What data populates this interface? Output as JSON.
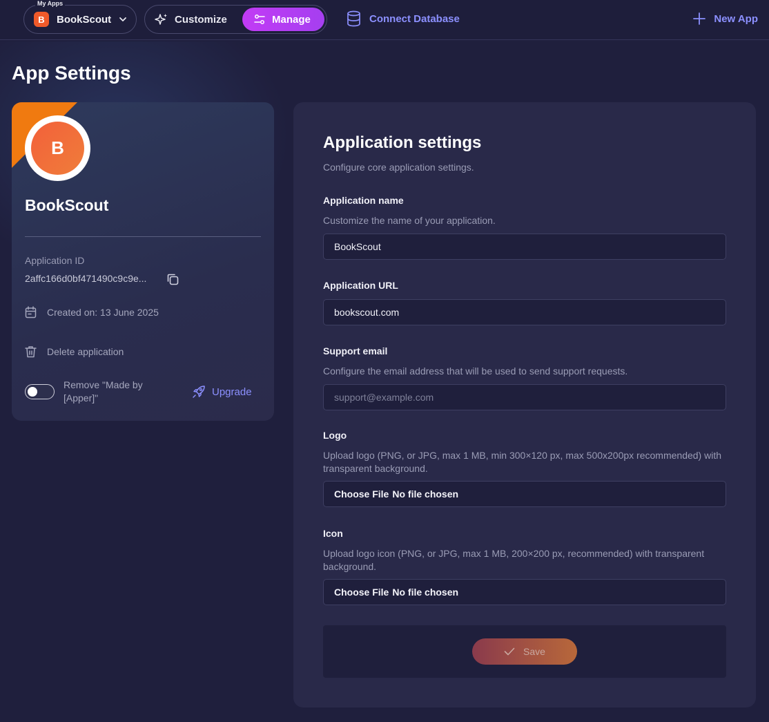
{
  "topbar": {
    "app_switch_legend": "My Apps",
    "app_initial": "B",
    "app_name": "BookScout",
    "mode_customize": "Customize",
    "mode_manage": "Manage",
    "connect_database": "Connect Database",
    "new_app": "New App"
  },
  "page": {
    "title": "App Settings"
  },
  "side": {
    "avatar_initial": "B",
    "app_name": "BookScout",
    "id_label": "Application ID",
    "id_value": "2affc166d0bf471490c9c9e...",
    "created_on": "Created on: 13 June 2025",
    "delete_label": "Delete application",
    "remove_label": "Remove \"Made by [Apper]\"",
    "toggle_on": false,
    "upgrade_label": "Upgrade"
  },
  "settings": {
    "title": "Application settings",
    "subtitle": "Configure core application settings.",
    "name_label": "Application name",
    "name_help": "Customize the name of your application.",
    "name_value": "BookScout",
    "url_label": "Application URL",
    "url_value": "bookscout.com",
    "email_label": "Support email",
    "email_help": "Configure the email address that will be used to send support requests.",
    "email_placeholder": "support@example.com",
    "logo_label": "Logo",
    "logo_help": "Upload logo (PNG, or JPG, max 1 MB, min 300×120 px, max 500x200px recommended) with transparent background.",
    "logo_choose": "Choose File",
    "logo_status": "No file chosen",
    "icon_label": "Icon",
    "icon_help": "Upload logo icon (PNG, or JPG, max 1 MB, 200×200 px, recommended) with transparent background.",
    "icon_choose": "Choose File",
    "icon_status": "No file chosen",
    "save_label": "Save"
  },
  "colors": {
    "background": "#1f1f3d",
    "card": "#292949",
    "accent_purple": "#c23bf5",
    "link_blue": "#8c90ff",
    "brand_orange": "#f05a2a"
  }
}
